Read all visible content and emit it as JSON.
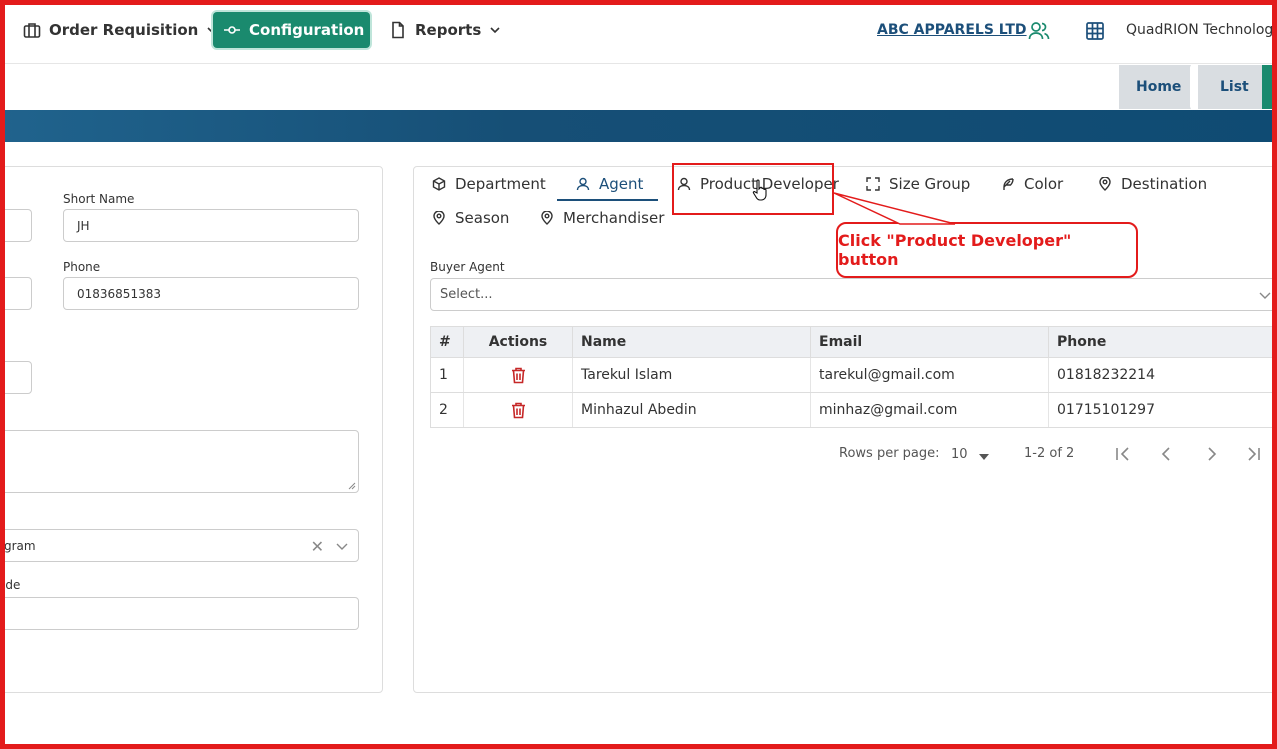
{
  "nav": {
    "order_requisition": "Order Requisition",
    "configuration": "Configuration",
    "reports": "Reports",
    "company": "ABC APPARELS LTD",
    "org": "QuadRION Technolog"
  },
  "breadcrumb": {
    "home": "Home",
    "list": "List"
  },
  "form": {
    "short_name_label": "Short Name",
    "short_name_value": "JH",
    "phone_label": "Phone",
    "phone_value": "01836851383",
    "select_value": "gram",
    "code_label": "ode"
  },
  "tabs": [
    {
      "label": "Department",
      "icon": "box-icon"
    },
    {
      "label": "Agent",
      "icon": "user-icon"
    },
    {
      "label": "Product Developer",
      "icon": "user-icon"
    },
    {
      "label": "Size Group",
      "icon": "expand-icon"
    },
    {
      "label": "Color",
      "icon": "feather-icon"
    },
    {
      "label": "Destination",
      "icon": "map-pin-icon"
    },
    {
      "label": "Season",
      "icon": "map-pin-icon"
    },
    {
      "label": "Merchandiser",
      "icon": "map-pin-icon"
    }
  ],
  "active_tab": "Agent",
  "buyer_agent": {
    "label": "Buyer Agent",
    "placeholder": "Select..."
  },
  "table": {
    "columns": [
      "#",
      "Actions",
      "Name",
      "Email",
      "Phone"
    ],
    "rows": [
      {
        "num": "1",
        "name": "Tarekul Islam",
        "email": "tarekul@gmail.com",
        "phone": "01818232214"
      },
      {
        "num": "2",
        "name": "Minhazul Abedin",
        "email": "minhaz@gmail.com",
        "phone": "01715101297"
      }
    ]
  },
  "pagination": {
    "rows_label": "Rows per page:",
    "rows_value": "10",
    "range": "1-2 of 2"
  },
  "callout": {
    "text": "Click \"Product Developer\" button"
  },
  "colors": {
    "accent": "#1a8a6e",
    "brand_blue": "#1c4f7a",
    "annotation_red": "#e31b1b",
    "delete_red": "#c62828"
  }
}
